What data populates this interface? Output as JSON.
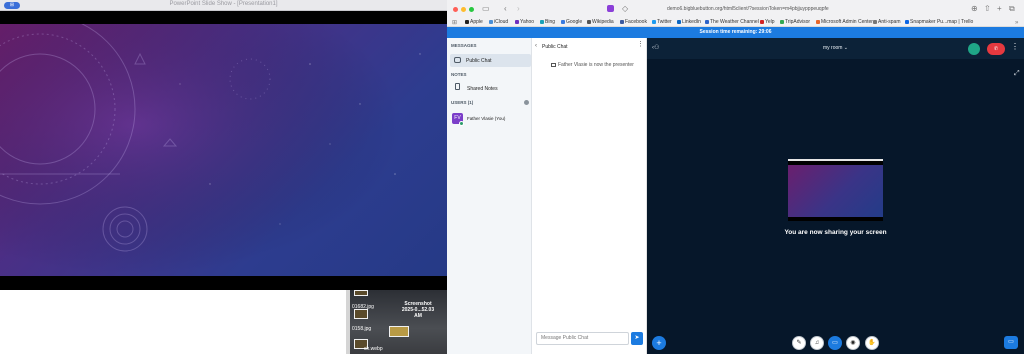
{
  "powerpoint": {
    "window_title": "PowerPoint Slide Show - [Presentation1]",
    "chip_label": "⊞"
  },
  "desktop": {
    "files": [
      {
        "name": "01682.jpg"
      },
      {
        "name": "0158.jpg"
      },
      {
        "name": "ch.webp"
      }
    ],
    "screenshot_label_1": "Screenshot",
    "screenshot_label_2": "2025-0...52.03 AM"
  },
  "safari": {
    "url": "demo6.bigbluebutton.org/html5client/?sessionToken=m4pbjjuypppeuqpfe",
    "bookmarks": [
      {
        "label": "Apple",
        "color": "#222222"
      },
      {
        "label": "iCloud",
        "color": "#4a8fd6"
      },
      {
        "label": "Yahoo",
        "color": "#6e2fbf"
      },
      {
        "label": "Bing",
        "color": "#1aa1b8"
      },
      {
        "label": "Google",
        "color": "#3a7be0"
      },
      {
        "label": "Wikipedia",
        "color": "#555555"
      },
      {
        "label": "Facebook",
        "color": "#3b5aa0"
      },
      {
        "label": "Twitter",
        "color": "#1d9bf0"
      },
      {
        "label": "LinkedIn",
        "color": "#0a66c2"
      },
      {
        "label": "The Weather Channel",
        "color": "#2d63c8"
      },
      {
        "label": "Yelp",
        "color": "#d32323"
      },
      {
        "label": "TripAdvisor",
        "color": "#34a853"
      },
      {
        "label": "Microsoft Admin Center",
        "color": "#e8672a"
      },
      {
        "label": "Anti-spam",
        "color": "#777777"
      },
      {
        "label": "Snapmaker Pu...map | Trello",
        "color": "#0c66e4"
      }
    ]
  },
  "bbb": {
    "session_time": "Session time remaining: 29:06",
    "sidebar": {
      "messages_label": "MESSAGES",
      "public_chat": "Public Chat",
      "notes_label": "NOTES",
      "shared_notes": "Shared Notes",
      "users_label": "USERS (1)",
      "user_initials": "FV",
      "user_name": "Father Vlasie (You)"
    },
    "chat": {
      "title": "Public Chat",
      "message": "Father Vlasie is now the presenter",
      "input_placeholder": "Message Public Chat",
      "send_icon": "➤"
    },
    "presentation": {
      "room_title": "my room",
      "sharing_text": "You are now sharing your screen",
      "leave_icon": "✆"
    },
    "colors": {
      "accent": "#1c7be0",
      "leave": "#e6393f",
      "connection": "#1fa687"
    }
  }
}
